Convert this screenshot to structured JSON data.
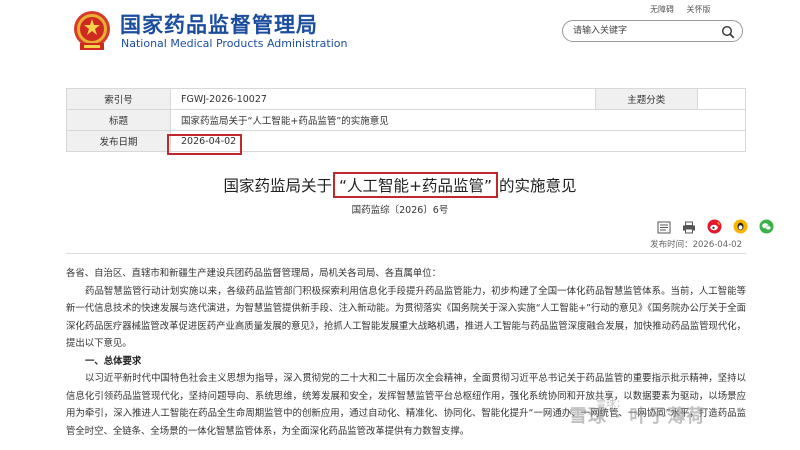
{
  "header": {
    "site_title": "国家药品监督管理局",
    "site_subtitle": "National Medical Products Administration",
    "top_links": [
      "无障碍",
      "关怀版"
    ],
    "search_placeholder": "请输入关键字"
  },
  "meta": {
    "index_label": "索引号",
    "index_value": "FGWJ-2026-10027",
    "category_label": "主题分类",
    "category_value": "",
    "title_label": "标题",
    "title_value": "国家药监局关于“人工智能+药品监管”的实施意见",
    "date_label": "发布日期",
    "date_value": "2026-04-02"
  },
  "article": {
    "title_pre": "国家药监局关于",
    "title_highlight": "“人工智能+药品监管”",
    "title_post": "的实施意见",
    "doc_number": "国药监综〔2026〕6号",
    "publish_line": "发布时间：2026-04-02",
    "paragraphs": {
      "salutation": "各省、自治区、直辖市和新疆生产建设兵团药品监督管理局，局机关各司局、各直属单位：",
      "p1": "药品智慧监管行动计划实施以来，各级药品监管部门积极探索利用信息化手段提升药品监管能力，初步构建了全国一体化药品智慧监管体系。当前，人工智能等新一代信息技术的快速发展与迭代演进，为智慧监管提供新手段、注入新动能。为贯彻落实《国务院关于深入实施“人工智能+”行动的意见》《国务院办公厅关于全面深化药品医疗器械监管改革促进医药产业高质量发展的意见》，抢抓人工智能发展重大战略机遇，推进人工智能与药品监管深度融合发展，加快推动药品监管现代化，提出以下意见。",
      "sec1": "一、总体要求",
      "p2": "以习近平新时代中国特色社会主义思想为指导，深入贯彻党的二十大和二十届历次全会精神，全面贯彻习近平总书记关于药品监管的重要指示批示精神，坚持以信息化引领药品监管现代化，坚持问题导向、系统思维，统筹发展和安全，发挥智慧监管平台总枢纽作用，强化系统协同和开放共享，以数据要素为驱动，以场景应用为牵引，深入推进人工智能在药品全生命周期监管中的创新应用，通过自动化、精准化、协同化、智能化提升“一网通办、一网统管、一网协同”水平，打造药品监管全时空、全链条、全场景的一体化智慧监管体系，为全面深化药品监管改革提供有力数智支撑。"
    }
  },
  "watermark": {
    "line1": "雪球：",
    "line2": "雪球 · 叶子薄荷"
  },
  "colors": {
    "brand_blue": "#1a4d9e",
    "highlight_red": "#c0282d",
    "table_label_bg": "#f0f0f0"
  },
  "icons": [
    "national-emblem-icon",
    "search-icon",
    "font-size-icon",
    "print-icon",
    "weibo-icon",
    "qq-icon",
    "wechat-icon"
  ]
}
